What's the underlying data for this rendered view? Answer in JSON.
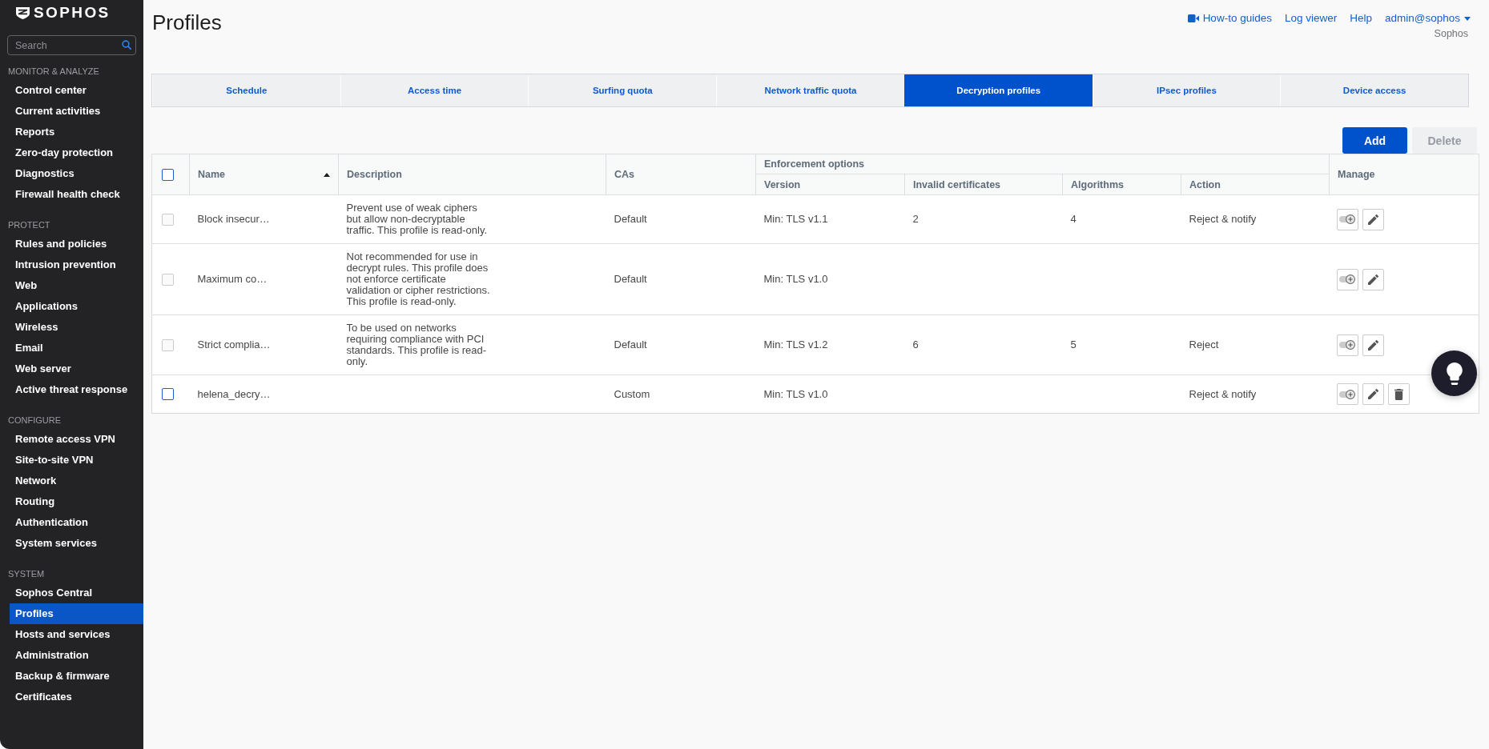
{
  "sidebar": {
    "logo": {
      "text": "SOPHOS"
    },
    "search": {
      "placeholder": "Search"
    },
    "sections": [
      {
        "title": "MONITOR & ANALYZE",
        "items": [
          {
            "label": "Control center",
            "selected": false
          },
          {
            "label": "Current activities",
            "selected": false
          },
          {
            "label": "Reports",
            "selected": false
          },
          {
            "label": "Zero-day protection",
            "selected": false
          },
          {
            "label": "Diagnostics",
            "selected": false
          },
          {
            "label": "Firewall health check",
            "selected": false
          }
        ]
      },
      {
        "title": "PROTECT",
        "items": [
          {
            "label": "Rules and policies",
            "selected": false
          },
          {
            "label": "Intrusion prevention",
            "selected": false
          },
          {
            "label": "Web",
            "selected": false
          },
          {
            "label": "Applications",
            "selected": false
          },
          {
            "label": "Wireless",
            "selected": false
          },
          {
            "label": "Email",
            "selected": false
          },
          {
            "label": "Web server",
            "selected": false
          },
          {
            "label": "Active threat response",
            "selected": false
          }
        ]
      },
      {
        "title": "CONFIGURE",
        "items": [
          {
            "label": "Remote access VPN",
            "selected": false
          },
          {
            "label": "Site-to-site VPN",
            "selected": false
          },
          {
            "label": "Network",
            "selected": false
          },
          {
            "label": "Routing",
            "selected": false
          },
          {
            "label": "Authentication",
            "selected": false
          },
          {
            "label": "System services",
            "selected": false
          }
        ]
      },
      {
        "title": "SYSTEM",
        "items": [
          {
            "label": "Sophos Central",
            "selected": false
          },
          {
            "label": "Profiles",
            "selected": true
          },
          {
            "label": "Hosts and services",
            "selected": false
          },
          {
            "label": "Administration",
            "selected": false
          },
          {
            "label": "Backup & firmware",
            "selected": false
          },
          {
            "label": "Certificates",
            "selected": false
          }
        ]
      }
    ]
  },
  "header": {
    "title": "Profiles",
    "links": [
      {
        "label": "How-to guides",
        "kind": "video"
      },
      {
        "label": "Log viewer",
        "kind": "plain"
      },
      {
        "label": "Help",
        "kind": "plain"
      }
    ],
    "account": {
      "user": "admin@sophos",
      "organization": "Sophos"
    }
  },
  "tabs": [
    {
      "label": "Schedule",
      "selected": false
    },
    {
      "label": "Access time",
      "selected": false
    },
    {
      "label": "Surfing quota",
      "selected": false
    },
    {
      "label": "Network traffic quota",
      "selected": false
    },
    {
      "label": "Decryption profiles",
      "selected": true
    },
    {
      "label": "IPsec profiles",
      "selected": false
    },
    {
      "label": "Device access",
      "selected": false
    }
  ],
  "toolbar": {
    "buttons": [
      {
        "label": "Add",
        "disabled": false
      },
      {
        "label": "Delete",
        "disabled": true
      }
    ]
  },
  "table": {
    "select_all": {
      "checked": false
    },
    "columns": [
      {
        "label": "Name",
        "sorted": true,
        "descending": false
      },
      {
        "label": "Description"
      },
      {
        "label": "CAs"
      }
    ],
    "group": {
      "label": "Enforcement options",
      "columns": [
        {
          "label": "Version"
        },
        {
          "label": "Invalid certificates"
        },
        {
          "label": "Algorithms"
        },
        {
          "label": "Action"
        }
      ]
    },
    "manage": {
      "label": "Manage"
    },
    "rows": [
      {
        "checked": false,
        "disabled": true,
        "name": "Block insecur…",
        "description": "Prevent use of weak ciphers but allow non-decryptable traffic. This profile is read-only.",
        "cas": "Default",
        "version": "Min: TLS v1.1",
        "invalid_certificates": "2",
        "algorithms": "4",
        "action": "Reject & notify",
        "actions": [
          {
            "kind": "toggle"
          },
          {
            "kind": "edit"
          }
        ]
      },
      {
        "checked": false,
        "disabled": true,
        "name": "Maximum co…",
        "description": "Not recommended for use in decrypt rules. This profile does not enforce certificate validation or cipher restrictions. This profile is read-only.",
        "cas": "Default",
        "version": "Min: TLS v1.0",
        "actions": [
          {
            "kind": "toggle"
          },
          {
            "kind": "edit"
          }
        ]
      },
      {
        "checked": false,
        "disabled": true,
        "name": "Strict complia…",
        "description": "To be used on networks requiring compliance with PCI standards. This profile is read-only.",
        "cas": "Default",
        "version": "Min: TLS v1.2",
        "invalid_certificates": "6",
        "algorithms": "5",
        "action": "Reject",
        "actions": [
          {
            "kind": "toggle"
          },
          {
            "kind": "edit"
          }
        ]
      },
      {
        "checked": false,
        "disabled": false,
        "name": "helena_decry…",
        "cas": "Custom",
        "version": "Min: TLS v1.0",
        "action": "Reject & notify",
        "actions": [
          {
            "kind": "toggle"
          },
          {
            "kind": "edit"
          },
          {
            "kind": "delete"
          }
        ]
      }
    ]
  }
}
